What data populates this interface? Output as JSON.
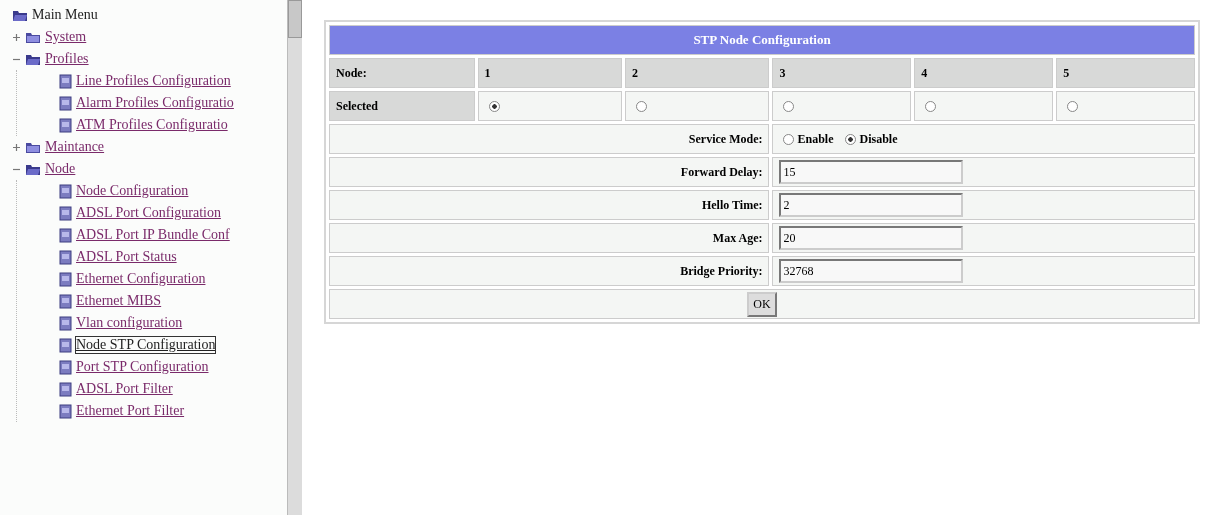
{
  "sidebar": {
    "tree": [
      {
        "label": "Main Menu",
        "kind": "root",
        "expanded": true,
        "children": [
          {
            "label": "System",
            "kind": "folder",
            "expanded": false
          },
          {
            "label": "Profiles",
            "kind": "folder",
            "expanded": true,
            "children": [
              {
                "label": "Line Profiles Configuration",
                "kind": "page",
                "selected": false
              },
              {
                "label": "Alarm Profiles Configuratio",
                "kind": "page",
                "selected": false
              },
              {
                "label": "ATM Profiles Configuratio",
                "kind": "page",
                "selected": false
              }
            ]
          },
          {
            "label": "Maintance",
            "kind": "folder",
            "expanded": false
          },
          {
            "label": "Node",
            "kind": "folder",
            "expanded": true,
            "children": [
              {
                "label": "Node Configuration",
                "kind": "page",
                "selected": false
              },
              {
                "label": "ADSL Port Configuration",
                "kind": "page",
                "selected": false
              },
              {
                "label": "ADSL Port IP Bundle Conf",
                "kind": "page",
                "selected": false
              },
              {
                "label": "ADSL Port Status",
                "kind": "page",
                "selected": false
              },
              {
                "label": "Ethernet Configuration",
                "kind": "page",
                "selected": false
              },
              {
                "label": "Ethernet MIBS",
                "kind": "page",
                "selected": false
              },
              {
                "label": "Vlan configuration",
                "kind": "page",
                "selected": false
              },
              {
                "label": "Node STP Configuration",
                "kind": "page",
                "selected": true
              },
              {
                "label": "Port STP Configuration",
                "kind": "page",
                "selected": false
              },
              {
                "label": "ADSL Port Filter",
                "kind": "page",
                "selected": false
              },
              {
                "label": "Ethernet Port Filter",
                "kind": "page",
                "selected": false
              }
            ]
          }
        ]
      }
    ]
  },
  "form": {
    "title": "STP Node Configuration",
    "node_header": "Node:",
    "nodes": [
      {
        "label": "1",
        "selected": true
      },
      {
        "label": "2",
        "selected": false
      },
      {
        "label": "3",
        "selected": false
      },
      {
        "label": "4",
        "selected": false
      },
      {
        "label": "5",
        "selected": false
      }
    ],
    "selected_label": "Selected",
    "service_mode": {
      "label": "Service Mode:",
      "options": [
        {
          "label": "Enable",
          "selected": false
        },
        {
          "label": "Disable",
          "selected": true
        }
      ]
    },
    "fields": [
      {
        "label": "Forward Delay:",
        "value": "15"
      },
      {
        "label": "Hello Time:",
        "value": "2"
      },
      {
        "label": "Max Age:",
        "value": "20"
      },
      {
        "label": "Bridge Priority:",
        "value": "32768"
      }
    ],
    "ok_button": "OK"
  }
}
